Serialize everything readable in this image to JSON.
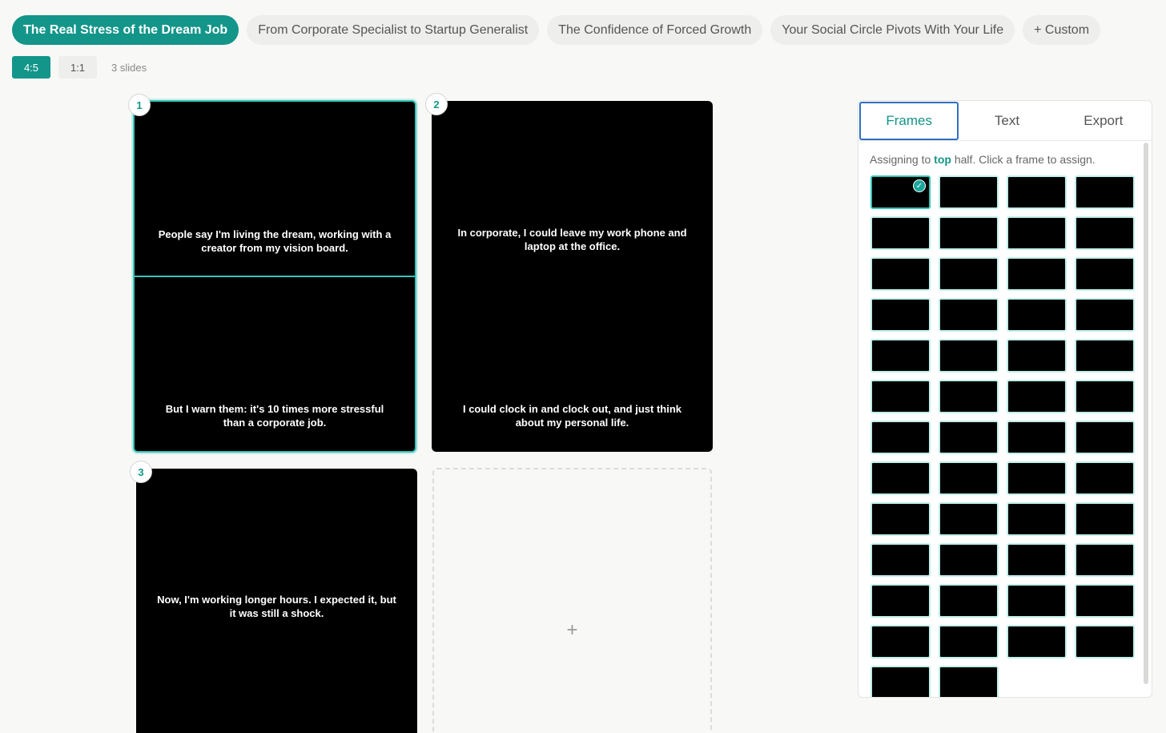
{
  "story_tabs": [
    {
      "label": "The Real Stress of the Dream Job",
      "active": true
    },
    {
      "label": "From Corporate Specialist to Startup Generalist",
      "active": false
    },
    {
      "label": "The Confidence of Forced Growth",
      "active": false
    },
    {
      "label": "Your Social Circle Pivots With Your Life",
      "active": false
    },
    {
      "label": "+ Custom",
      "active": false
    }
  ],
  "ratios": [
    {
      "label": "4:5",
      "active": true
    },
    {
      "label": "1:1",
      "active": false
    }
  ],
  "slide_count": "3 slides",
  "slides": [
    {
      "number": "1",
      "top_text": "People say I'm living the dream, working with a creator from my vision board.",
      "bottom_text": "But I warn them: it's 10 times more stressful than a corporate job."
    },
    {
      "number": "2",
      "top_text": "In corporate, I could leave my work phone and laptop at the office.",
      "bottom_text": "I could clock in and clock out, and just think about my personal life."
    },
    {
      "number": "3",
      "top_text": "Now, I'm working longer hours. I expected it, but it was still a shock."
    }
  ],
  "add_slide_label": "+",
  "panel": {
    "tabs": [
      "Frames",
      "Text",
      "Export"
    ],
    "active_tab": "Frames",
    "assign_prefix": "Assigning to",
    "assign_target": "top",
    "assign_suffix": "half. Click a frame to assign.",
    "frame_count": 50,
    "selected_frame": 0,
    "check_glyph": "✓"
  },
  "colors": {
    "accent": "#13958a",
    "accent_light": "#34c4b8",
    "tab_focus": "#2f6fc0"
  }
}
